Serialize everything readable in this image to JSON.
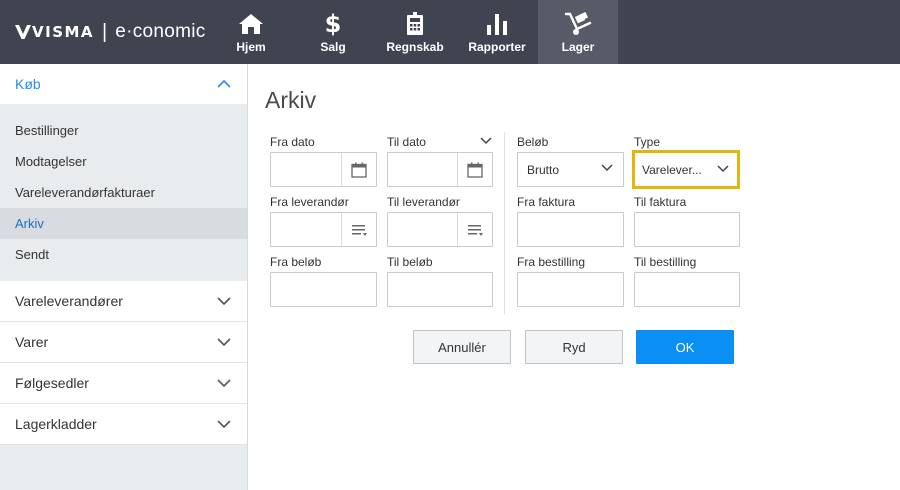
{
  "brand": {
    "visma": "VISMA",
    "product": "e·conomic"
  },
  "nav": [
    {
      "label": "Hjem",
      "icon": "home-icon"
    },
    {
      "label": "Salg",
      "icon": "dollar-icon"
    },
    {
      "label": "Regnskab",
      "icon": "calculator-icon"
    },
    {
      "label": "Rapporter",
      "icon": "bar-chart-icon"
    },
    {
      "label": "Lager",
      "icon": "hand-truck-icon"
    }
  ],
  "sidebar": {
    "section": "Køb",
    "items": [
      {
        "label": "Bestillinger"
      },
      {
        "label": "Modtagelser"
      },
      {
        "label": "Vareleverandørfakturaer"
      },
      {
        "label": "Arkiv"
      },
      {
        "label": "Sendt"
      }
    ],
    "groups": [
      {
        "label": "Vareleverandører"
      },
      {
        "label": "Varer"
      },
      {
        "label": "Følgesedler"
      },
      {
        "label": "Lagerkladder"
      }
    ]
  },
  "page": {
    "title": "Arkiv"
  },
  "filters": {
    "fra_dato": {
      "label": "Fra dato",
      "value": ""
    },
    "til_dato": {
      "label": "Til dato",
      "value": ""
    },
    "fra_leverandor": {
      "label": "Fra leverandør",
      "value": ""
    },
    "til_leverandor": {
      "label": "Til leverandør",
      "value": ""
    },
    "fra_belob": {
      "label": "Fra beløb",
      "value": ""
    },
    "til_belob": {
      "label": "Til beløb",
      "value": ""
    },
    "belob": {
      "label": "Beløb",
      "value": "Brutto"
    },
    "type": {
      "label": "Type",
      "value": "Varelever..."
    },
    "fra_faktura": {
      "label": "Fra faktura",
      "value": ""
    },
    "til_faktura": {
      "label": "Til faktura",
      "value": ""
    },
    "fra_bestilling": {
      "label": "Fra bestilling",
      "value": ""
    },
    "til_bestilling": {
      "label": "Til bestilling",
      "value": ""
    }
  },
  "buttons": {
    "cancel": "Annullér",
    "clear": "Ryd",
    "ok": "OK"
  },
  "colors": {
    "topbar": "#404451",
    "accent": "#0a8ff5",
    "highlight": "#e3b60a",
    "sidebar_bg": "#e9ecee"
  }
}
